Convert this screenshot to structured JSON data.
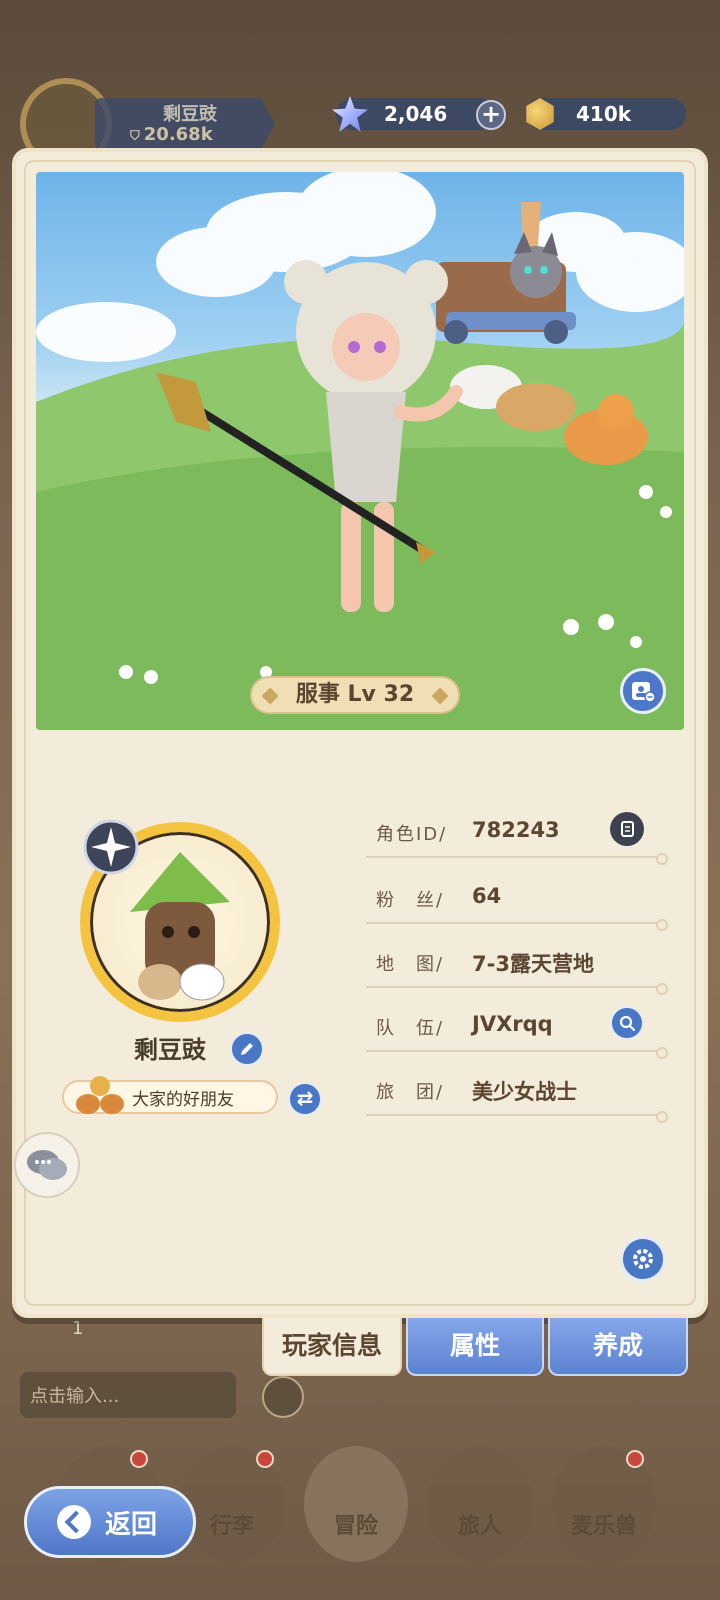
{
  "hud": {
    "player_name": "剩豆豉",
    "power": "20.68k",
    "gems": "2,046",
    "coins": "410k"
  },
  "profile": {
    "level_label": "服事 Lv 32",
    "player_name": "剩豆豉",
    "title_badge": "大家的好朋友",
    "info_rows": [
      {
        "label": "角色ID/",
        "value": "782243"
      },
      {
        "label": "粉　丝/",
        "value": "64"
      },
      {
        "label": "地　图/",
        "value": "7-3露天营地"
      },
      {
        "label": "队　伍/",
        "value": "JVXrqq"
      },
      {
        "label": "旅　团/",
        "value": "美少女战士"
      }
    ]
  },
  "tabs": {
    "player_info": "玩家信息",
    "attributes": "属性",
    "growth": "养成"
  },
  "bottom": {
    "message_placeholder": "点击输入...",
    "count": "1",
    "nav": [
      "行李",
      "冒险",
      "旅人",
      "麦乐兽"
    ],
    "back_label": "返回"
  },
  "colors": {
    "accent_blue": "#4a76c6",
    "card_bg": "#f4ecda",
    "text_brown": "#5b4633",
    "badge_red": "#c9463c"
  }
}
